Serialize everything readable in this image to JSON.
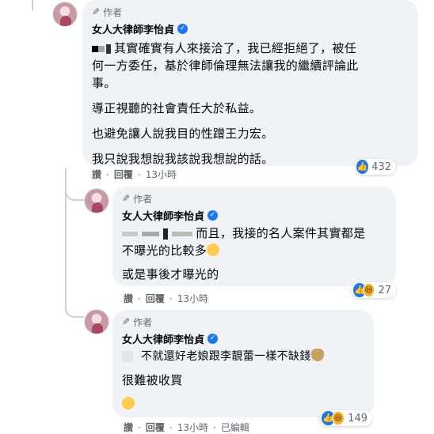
{
  "comments": [
    {
      "badge": "作者",
      "name": "女人大律師李怡貞",
      "paragraphs": [
        "其實確實有人來接洽了，我已經拒絕了，被任何一方委任，基於律師倫理無法讓我的繼續評論此事。",
        "導正視聽的社會責任大於私益。",
        "也避免讓人說我目的性蹭王力宏。",
        "我只說我想說我該說我想說的話。"
      ],
      "line1_lead": "其實確實有人來接洽了，我已經拒絕了，被任",
      "line1_rest": "何一方委任，基於律師倫理無法讓我的繼續評論此",
      "line1_end": "事。",
      "actions": {
        "like": "讚",
        "reply": "回覆",
        "time": "13小時"
      },
      "reaction_count": "432"
    },
    {
      "badge": "作者",
      "name": "女人大律師李怡貞",
      "lead": "而且，我接的名人案件其實都是",
      "line2": "不曝光的比較多",
      "paragraph2": "或是事後才曝光的",
      "actions": {
        "like": "讚",
        "reply": "回覆",
        "time": "13小時"
      },
      "reaction_count": "27"
    },
    {
      "badge": "作者",
      "name": "女人大律師李怡貞",
      "lead": "不就還好老娘跟李靚蕾一樣不缺錢",
      "paragraph2": "很難被收買",
      "actions": {
        "like": "讚",
        "reply": "回覆",
        "time": "13小時",
        "edited": "已編輯"
      },
      "reaction_count": "149"
    }
  ],
  "icons": {
    "pencil": "pencil-icon",
    "verified": "verified-check-icon",
    "like": "like-reaction-icon",
    "haha": "haha-reaction-icon",
    "money_bag": "money-bag-emoji"
  },
  "colors": {
    "bubble": "#f0f2f5",
    "link": "#65676b",
    "verified": "#1877f2"
  }
}
